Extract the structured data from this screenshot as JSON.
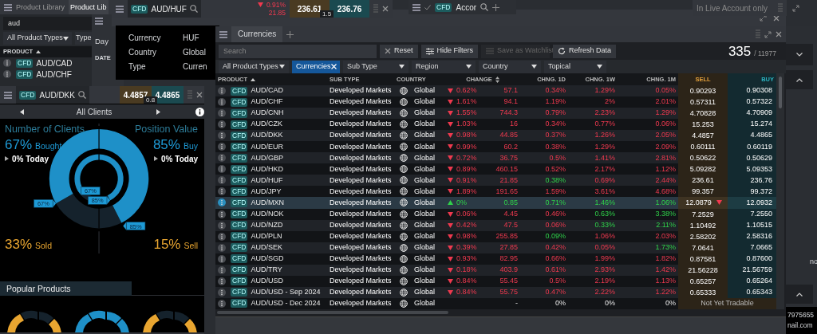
{
  "product_library": {
    "tabs": [
      {
        "label": "Product Library",
        "selected": false
      },
      {
        "label": "Product Lib",
        "selected": true
      }
    ],
    "search": {
      "value": "aud"
    },
    "filters": [
      "All Product Types",
      "Type"
    ],
    "column": {
      "label": "PRODUCT",
      "sorted": true,
      "sortable": false
    },
    "rows": [
      {
        "badge": "CFD",
        "name": "AUD/CAD"
      },
      {
        "badge": "CFD",
        "name": "AUD/CHF"
      }
    ]
  },
  "day_window": {
    "tab": "Day",
    "column": "DATE"
  },
  "huf_window": {
    "badge": "CFD",
    "name": "AUD/HUF",
    "change": {
      "falling": true,
      "rising": false,
      "pct": "0.91%",
      "points": "21.85"
    },
    "sell": "236.61",
    "buy": "236.76",
    "spread": "1.5",
    "details": [
      {
        "label": "Currency",
        "value": "HUF"
      },
      {
        "label": "Country",
        "value": "Global"
      },
      {
        "label": "Type",
        "value": "Curren"
      }
    ]
  },
  "accor_tab": {
    "badge": "CFD",
    "name": "Accor"
  },
  "account_notice": "In Live Account only",
  "currencies": {
    "tab": {
      "label": "Currencies",
      "selected": true
    },
    "search": {
      "placeholder": "Search"
    },
    "buttons": [
      {
        "label": "Reset",
        "kind": "reset",
        "disabled": false
      },
      {
        "label": "Hide Filters",
        "kind": "filters",
        "disabled": false
      },
      {
        "label": "Save as Watchlist",
        "kind": "watchlist",
        "disabled": true
      },
      {
        "label": "Refresh Data",
        "kind": "refresh",
        "disabled": false
      }
    ],
    "count": "335",
    "total": "/ 11977",
    "filters": [
      {
        "label": "All Product Types",
        "kind": "dropdown"
      },
      {
        "label": "Currencies",
        "kind": "chip"
      },
      {
        "label": "Sub Type",
        "kind": "dropdown"
      },
      {
        "label": "Region",
        "kind": "dropdown"
      },
      {
        "label": "Country",
        "kind": "dropdown"
      },
      {
        "label": "Topical",
        "kind": "dropdown"
      }
    ],
    "columns": [
      {
        "label": "PRODUCT",
        "sorted": true,
        "sortable": false,
        "kind": "text"
      },
      {
        "label": "SUB TYPE",
        "sorted": false,
        "sortable": false,
        "kind": "text"
      },
      {
        "label": "COUNTRY",
        "sorted": false,
        "sortable": false,
        "kind": "text"
      },
      {
        "label": "CHANGE",
        "sorted": false,
        "sortable": true,
        "kind": "center"
      },
      {
        "label": "CHNG. 1D",
        "sorted": false,
        "sortable": false,
        "kind": "num"
      },
      {
        "label": "CHNG. 1W",
        "sorted": false,
        "sortable": false,
        "kind": "num"
      },
      {
        "label": "CHNG. 1M",
        "sorted": false,
        "sortable": false,
        "kind": "num"
      },
      {
        "label": "SELL",
        "sorted": false,
        "sortable": false,
        "kind": "sell"
      },
      {
        "label": "BUY",
        "sorted": false,
        "sortable": false,
        "kind": "buy"
      }
    ],
    "rows": [
      {
        "selected": false,
        "badge": "CFD",
        "name": "AUD/CAD",
        "sub_type": "Developed Markets",
        "country": "Global",
        "change": {
          "falling": true,
          "rising": false,
          "pct": "0.62%",
          "points": "57.1"
        },
        "periods": [
          {
            "falling": true,
            "rising": false,
            "value": "0.34%"
          },
          {
            "falling": true,
            "rising": false,
            "value": "1.29%"
          },
          {
            "falling": true,
            "rising": false,
            "value": "0.05%"
          }
        ],
        "sell": "0.90293",
        "sell_falling": false,
        "buy": "0.90308"
      },
      {
        "selected": false,
        "badge": "CFD",
        "name": "AUD/CHF",
        "sub_type": "Developed Markets",
        "country": "Global",
        "change": {
          "falling": true,
          "rising": false,
          "pct": "1.61%",
          "points": "94.1"
        },
        "periods": [
          {
            "falling": true,
            "rising": false,
            "value": "1.19%"
          },
          {
            "falling": true,
            "rising": false,
            "value": "2%"
          },
          {
            "falling": true,
            "rising": false,
            "value": "2.01%"
          }
        ],
        "sell": "0.57311",
        "sell_falling": false,
        "buy": "0.57322"
      },
      {
        "selected": false,
        "badge": "CFD",
        "name": "AUD/CNH",
        "sub_type": "Developed Markets",
        "country": "Global",
        "change": {
          "falling": true,
          "rising": false,
          "pct": "1.55%",
          "points": "744.3"
        },
        "periods": [
          {
            "falling": true,
            "rising": false,
            "value": "0.79%"
          },
          {
            "falling": true,
            "rising": false,
            "value": "2.23%"
          },
          {
            "falling": true,
            "rising": false,
            "value": "1.29%"
          }
        ],
        "sell": "4.70828",
        "sell_falling": false,
        "buy": "4.70909"
      },
      {
        "selected": false,
        "badge": "CFD",
        "name": "AUD/CZK",
        "sub_type": "Developed Markets",
        "country": "Global",
        "change": {
          "falling": true,
          "rising": false,
          "pct": "1.03%",
          "points": "16"
        },
        "periods": [
          {
            "falling": true,
            "rising": false,
            "value": "0.34%"
          },
          {
            "falling": true,
            "rising": false,
            "value": "0.77%"
          },
          {
            "falling": true,
            "rising": false,
            "value": "0.06%"
          }
        ],
        "sell": "15.253",
        "sell_falling": false,
        "buy": "15.274"
      },
      {
        "selected": false,
        "badge": "CFD",
        "name": "AUD/DKK",
        "sub_type": "Developed Markets",
        "country": "Global",
        "change": {
          "falling": true,
          "rising": false,
          "pct": "0.98%",
          "points": "44.85"
        },
        "periods": [
          {
            "falling": true,
            "rising": false,
            "value": "0.37%"
          },
          {
            "falling": true,
            "rising": false,
            "value": "1.26%"
          },
          {
            "falling": true,
            "rising": false,
            "value": "2.05%"
          }
        ],
        "sell": "4.4857",
        "sell_falling": false,
        "buy": "4.4865"
      },
      {
        "selected": false,
        "badge": "CFD",
        "name": "AUD/EUR",
        "sub_type": "Developed Markets",
        "country": "Global",
        "change": {
          "falling": true,
          "rising": false,
          "pct": "0.99%",
          "points": "60.2"
        },
        "periods": [
          {
            "falling": true,
            "rising": false,
            "value": "0.38%"
          },
          {
            "falling": true,
            "rising": false,
            "value": "1.29%"
          },
          {
            "falling": true,
            "rising": false,
            "value": "2.09%"
          }
        ],
        "sell": "0.60111",
        "sell_falling": false,
        "buy": "0.60119"
      },
      {
        "selected": false,
        "badge": "CFD",
        "name": "AUD/GBP",
        "sub_type": "Developed Markets",
        "country": "Global",
        "change": {
          "falling": true,
          "rising": false,
          "pct": "0.72%",
          "points": "36.75"
        },
        "periods": [
          {
            "falling": true,
            "rising": false,
            "value": "0.5%"
          },
          {
            "falling": true,
            "rising": false,
            "value": "1.41%"
          },
          {
            "falling": true,
            "rising": false,
            "value": "2.81%"
          }
        ],
        "sell": "0.50622",
        "sell_falling": false,
        "buy": "0.50629"
      },
      {
        "selected": false,
        "badge": "CFD",
        "name": "AUD/HKD",
        "sub_type": "Developed Markets",
        "country": "Global",
        "change": {
          "falling": true,
          "rising": false,
          "pct": "0.89%",
          "points": "460.15"
        },
        "periods": [
          {
            "falling": true,
            "rising": false,
            "value": "0.52%"
          },
          {
            "falling": true,
            "rising": false,
            "value": "2.17%"
          },
          {
            "falling": true,
            "rising": false,
            "value": "1.12%"
          }
        ],
        "sell": "5.09282",
        "sell_falling": false,
        "buy": "5.09353"
      },
      {
        "selected": false,
        "badge": "CFD",
        "name": "AUD/HUF",
        "sub_type": "Developed Markets",
        "country": "Global",
        "change": {
          "falling": true,
          "rising": false,
          "pct": "0.91%",
          "points": "21.85"
        },
        "periods": [
          {
            "falling": false,
            "rising": true,
            "value": "0.38%"
          },
          {
            "falling": true,
            "rising": false,
            "value": "0.69%"
          },
          {
            "falling": true,
            "rising": false,
            "value": "2.44%"
          }
        ],
        "sell": "236.61",
        "sell_falling": false,
        "buy": "236.76"
      },
      {
        "selected": false,
        "badge": "CFD",
        "name": "AUD/JPY",
        "sub_type": "Developed Markets",
        "country": "Global",
        "change": {
          "falling": true,
          "rising": false,
          "pct": "1.89%",
          "points": "191.65"
        },
        "periods": [
          {
            "falling": true,
            "rising": false,
            "value": "1.59%"
          },
          {
            "falling": true,
            "rising": false,
            "value": "3.61%"
          },
          {
            "falling": true,
            "rising": false,
            "value": "4.68%"
          }
        ],
        "sell": "99.357",
        "sell_falling": false,
        "buy": "99.372"
      },
      {
        "selected": true,
        "badge": "CFD",
        "name": "AUD/MXN",
        "sub_type": "Developed Markets",
        "country": "Global",
        "change": {
          "falling": false,
          "rising": true,
          "pct": "0%",
          "points": "0.85"
        },
        "periods": [
          {
            "falling": false,
            "rising": true,
            "value": "0.71%"
          },
          {
            "falling": false,
            "rising": true,
            "value": "1.46%"
          },
          {
            "falling": false,
            "rising": true,
            "value": "1.06%"
          }
        ],
        "sell": "12.0879",
        "sell_falling": true,
        "buy": "12.0932"
      },
      {
        "selected": false,
        "badge": "CFD",
        "name": "AUD/NOK",
        "sub_type": "Developed Markets",
        "country": "Global",
        "change": {
          "falling": true,
          "rising": false,
          "pct": "0.06%",
          "points": "4.45"
        },
        "periods": [
          {
            "falling": true,
            "rising": false,
            "value": "0.46%"
          },
          {
            "falling": false,
            "rising": true,
            "value": "0.63%"
          },
          {
            "falling": false,
            "rising": true,
            "value": "3.38%"
          }
        ],
        "sell": "7.2529",
        "sell_falling": false,
        "buy": "7.2550"
      },
      {
        "selected": false,
        "badge": "CFD",
        "name": "AUD/NZD",
        "sub_type": "Developed Markets",
        "country": "Global",
        "change": {
          "falling": true,
          "rising": false,
          "pct": "0.42%",
          "points": "47.5"
        },
        "periods": [
          {
            "falling": true,
            "rising": false,
            "value": "0.06%"
          },
          {
            "falling": false,
            "rising": true,
            "value": "0.33%"
          },
          {
            "falling": false,
            "rising": true,
            "value": "2.11%"
          }
        ],
        "sell": "1.10492",
        "sell_falling": false,
        "buy": "1.10515"
      },
      {
        "selected": false,
        "badge": "CFD",
        "name": "AUD/PLN",
        "sub_type": "Developed Markets",
        "country": "Global",
        "change": {
          "falling": true,
          "rising": false,
          "pct": "0.98%",
          "points": "255.85"
        },
        "periods": [
          {
            "falling": false,
            "rising": true,
            "value": "0.09%"
          },
          {
            "falling": true,
            "rising": false,
            "value": "1.06%"
          },
          {
            "falling": true,
            "rising": false,
            "value": "2.03%"
          }
        ],
        "sell": "2.58202",
        "sell_falling": false,
        "buy": "2.58316"
      },
      {
        "selected": false,
        "badge": "CFD",
        "name": "AUD/SEK",
        "sub_type": "Developed Markets",
        "country": "Global",
        "change": {
          "falling": true,
          "rising": false,
          "pct": "0.39%",
          "points": "27.85"
        },
        "periods": [
          {
            "falling": true,
            "rising": false,
            "value": "0.42%"
          },
          {
            "falling": true,
            "rising": false,
            "value": "0.05%"
          },
          {
            "falling": false,
            "rising": true,
            "value": "1.73%"
          }
        ],
        "sell": "7.0641",
        "sell_falling": false,
        "buy": "7.0665"
      },
      {
        "selected": false,
        "badge": "CFD",
        "name": "AUD/SGD",
        "sub_type": "Developed Markets",
        "country": "Global",
        "change": {
          "falling": true,
          "rising": false,
          "pct": "0.93%",
          "points": "82.95"
        },
        "periods": [
          {
            "falling": true,
            "rising": false,
            "value": "0.66%"
          },
          {
            "falling": true,
            "rising": false,
            "value": "1.99%"
          },
          {
            "falling": true,
            "rising": false,
            "value": "1.82%"
          }
        ],
        "sell": "0.87581",
        "sell_falling": false,
        "buy": "0.87600"
      },
      {
        "selected": false,
        "badge": "CFD",
        "name": "AUD/TRY",
        "sub_type": "Developed Markets",
        "country": "Global",
        "change": {
          "falling": true,
          "rising": false,
          "pct": "0.18%",
          "points": "403.9"
        },
        "periods": [
          {
            "falling": true,
            "rising": false,
            "value": "0.61%"
          },
          {
            "falling": true,
            "rising": false,
            "value": "2.93%"
          },
          {
            "falling": true,
            "rising": false,
            "value": "1.42%"
          }
        ],
        "sell": "21.56228",
        "sell_falling": false,
        "buy": "21.56759"
      },
      {
        "selected": false,
        "badge": "CFD",
        "name": "AUD/USD",
        "sub_type": "Developed Markets",
        "country": "Global",
        "change": {
          "falling": true,
          "rising": false,
          "pct": "0.84%",
          "points": "55.45"
        },
        "periods": [
          {
            "falling": true,
            "rising": false,
            "value": "0.5%"
          },
          {
            "falling": true,
            "rising": false,
            "value": "2.19%"
          },
          {
            "falling": true,
            "rising": false,
            "value": "1.13%"
          }
        ],
        "sell": "0.65257",
        "sell_falling": false,
        "buy": "0.65264"
      },
      {
        "selected": false,
        "badge": "CFD",
        "name": "AUD/USD - Sep 2024",
        "sub_type": "Developed Markets",
        "country": "Global",
        "change": {
          "falling": true,
          "rising": false,
          "pct": "0.84%",
          "points": "55.75"
        },
        "periods": [
          {
            "falling": true,
            "rising": false,
            "value": "0.47%"
          },
          {
            "falling": true,
            "rising": false,
            "value": "2.22%"
          },
          {
            "falling": true,
            "rising": false,
            "value": "1.22%"
          }
        ],
        "sell": "0.65333",
        "sell_falling": false,
        "buy": "0.65343"
      },
      {
        "selected": false,
        "badge": "CFD",
        "name": "AUD/USD - Dec 2024",
        "sub_type": "Developed Markets",
        "country": "Global",
        "change": {
          "falling": false,
          "rising": false,
          "points": "-"
        },
        "periods": [
          {
            "falling": false,
            "rising": false,
            "value": "0%"
          },
          {
            "falling": false,
            "rising": false,
            "value": "0%"
          },
          {
            "falling": false,
            "rising": false,
            "value": "0%"
          }
        ],
        "status": "Not Yet Tradable"
      }
    ]
  },
  "sentiment": {
    "badge": "CFD",
    "name": "AUD/DKK",
    "sell": "4.4857",
    "buy": "4.4865",
    "spread": "0.8",
    "audience": "All Clients",
    "left": {
      "title": "Number of Clients",
      "pct": "67%",
      "label": "Bought",
      "today": "0% Today",
      "inner_label": "67%",
      "outer_label": "67%",
      "rest_pct": "33%",
      "rest_label": "Sold"
    },
    "right": {
      "title": "Position Value",
      "pct": "85%",
      "label": "Buy",
      "today": "0% Today",
      "inner_label": "85%",
      "outer_label": "85%",
      "rest_pct": "15%",
      "rest_label": "Sell"
    },
    "popular_title": "Popular Products"
  },
  "side_panel": {
    "texts": [
      "no",
      "7975655",
      "nail.com"
    ]
  }
}
